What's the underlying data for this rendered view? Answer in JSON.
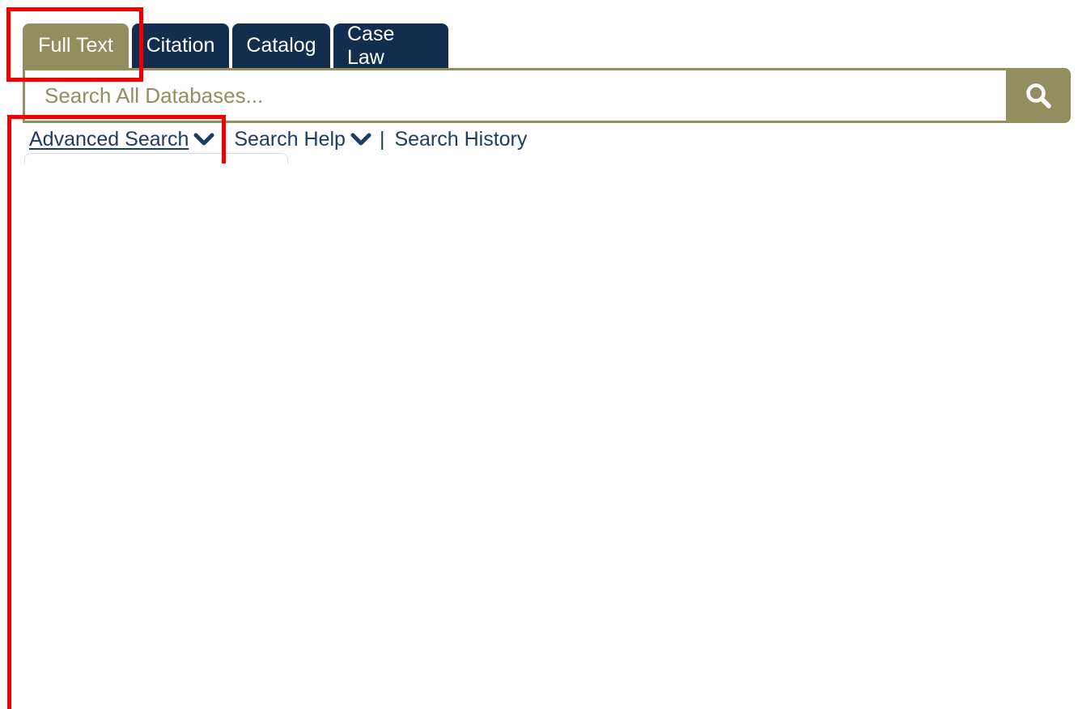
{
  "tabs": [
    {
      "label": "Full Text",
      "active": true
    },
    {
      "label": "Citation",
      "active": false
    },
    {
      "label": "Catalog",
      "active": false
    },
    {
      "label": "Case Law",
      "active": false
    }
  ],
  "search": {
    "placeholder": "Search All Databases...",
    "value": "",
    "button_icon": "search-icon"
  },
  "links": {
    "advanced_search": "Advanced Search",
    "search_help": "Search Help",
    "separator": "|",
    "search_history": "Search History"
  },
  "colors": {
    "tab_active": "#938e5f",
    "tab_inactive": "#132d4f",
    "link": "#1d3c66",
    "annotation": "#f10000"
  }
}
